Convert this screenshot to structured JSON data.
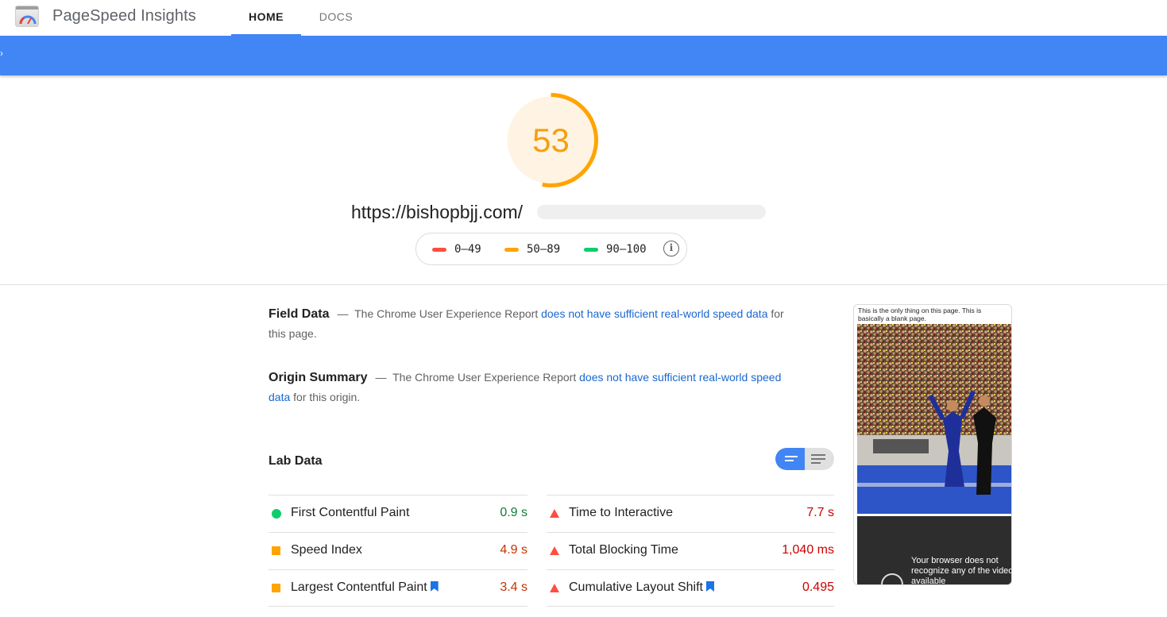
{
  "app": {
    "title": "PageSpeed Insights",
    "tabs": [
      {
        "label": "HOME",
        "active": true
      },
      {
        "label": "DOCS",
        "active": false
      }
    ]
  },
  "score": {
    "value": "53",
    "fraction": 0.53,
    "color": "#ffa400",
    "url": "https://bishopbjj.com/"
  },
  "legend": {
    "items": [
      {
        "label": "0–49",
        "color": "#ff4e42"
      },
      {
        "label": "50–89",
        "color": "#ffa400"
      },
      {
        "label": "90–100",
        "color": "#0cce6b"
      }
    ],
    "info_icon": "info-icon"
  },
  "field_data": {
    "title": "Field Data",
    "dash": "—",
    "text_before": "The Chrome User Experience Report",
    "link": "does not have sufficient real-world speed data",
    "text_after": "for this page."
  },
  "origin_summary": {
    "title": "Origin Summary",
    "dash": "—",
    "text_before": "The Chrome User Experience Report",
    "link": "does not have sufficient real-world speed data",
    "text_after": "for this origin."
  },
  "lab_data": {
    "title": "Lab Data",
    "view_toggle": {
      "selected": "collapsed-view",
      "options": [
        "collapsed-view-icon",
        "expanded-view-icon"
      ]
    },
    "metrics_left": [
      {
        "name": "First Contentful Paint",
        "value": "0.9 s",
        "rating": "pass",
        "bookmark": false
      },
      {
        "name": "Speed Index",
        "value": "4.9 s",
        "rating": "average",
        "bookmark": false
      },
      {
        "name": "Largest Contentful Paint",
        "value": "3.4 s",
        "rating": "average",
        "bookmark": true
      }
    ],
    "metrics_right": [
      {
        "name": "Time to Interactive",
        "value": "7.7 s",
        "rating": "fail",
        "bookmark": false
      },
      {
        "name": "Total Blocking Time",
        "value": "1,040 ms",
        "rating": "fail",
        "bookmark": false
      },
      {
        "name": "Cumulative Layout Shift",
        "value": "0.495",
        "rating": "fail",
        "bookmark": true
      }
    ],
    "rating_colors": {
      "pass": "#0d7e3a",
      "average": "#c33300",
      "fail": "#cc0000"
    }
  },
  "screenshot": {
    "caption": "This is the only thing on this page. This is basically a blank page.",
    "video_message": "Your browser does not recognize any of the video available"
  }
}
